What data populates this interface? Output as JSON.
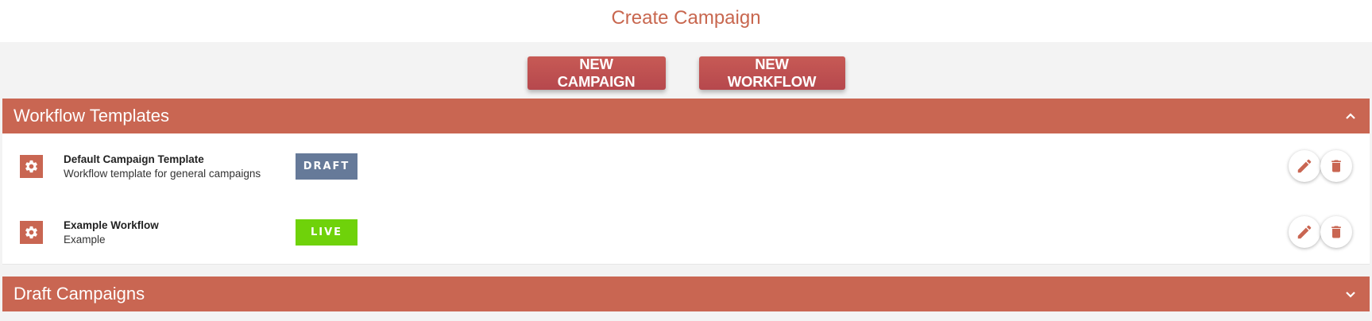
{
  "page": {
    "title": "Create Campaign"
  },
  "actions": {
    "new_campaign": "NEW CAMPAIGN",
    "new_workflow": "NEW WORKFLOW"
  },
  "colors": {
    "accent": "#c96652",
    "button": "#b94a4e",
    "draft": "#667a99",
    "live": "#6fd20a"
  },
  "sections": [
    {
      "title": "Workflow Templates",
      "expanded": true,
      "items": [
        {
          "name": "Default Campaign Template",
          "description": "Workflow template for general campaigns",
          "status": "DRAFT",
          "icon": "gear-icon"
        },
        {
          "name": "Example Workflow",
          "description": "Example",
          "status": "LIVE",
          "icon": "gear-icon"
        }
      ]
    },
    {
      "title": "Draft Campaigns",
      "expanded": false
    }
  ]
}
